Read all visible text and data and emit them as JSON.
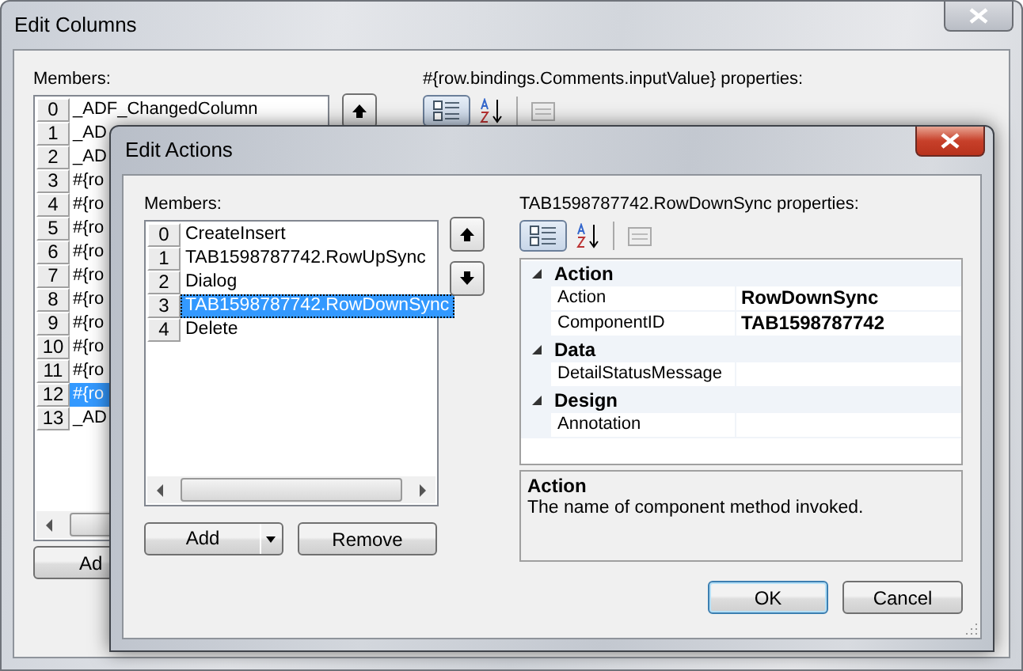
{
  "outer_window": {
    "title": "Edit Columns",
    "members_label": "Members:",
    "members": [
      {
        "index": "0",
        "name": "_ADF_ChangedColumn",
        "selected": false
      },
      {
        "index": "1",
        "name": "_AD",
        "selected": false
      },
      {
        "index": "2",
        "name": "_AD",
        "selected": false
      },
      {
        "index": "3",
        "name": "#{ro",
        "selected": false
      },
      {
        "index": "4",
        "name": "#{ro",
        "selected": false
      },
      {
        "index": "5",
        "name": "#{ro",
        "selected": false
      },
      {
        "index": "6",
        "name": "#{ro",
        "selected": false
      },
      {
        "index": "7",
        "name": "#{ro",
        "selected": false
      },
      {
        "index": "8",
        "name": "#{ro",
        "selected": false
      },
      {
        "index": "9",
        "name": "#{ro",
        "selected": false
      },
      {
        "index": "10",
        "name": "#{ro",
        "selected": false
      },
      {
        "index": "11",
        "name": "#{ro",
        "selected": false
      },
      {
        "index": "12",
        "name": "#{ro",
        "selected": true
      },
      {
        "index": "13",
        "name": "_AD",
        "selected": false
      }
    ],
    "add_button": "Ad",
    "properties_label": "#{row.bindings.Comments.inputValue} properties:",
    "toolbar": [
      {
        "kind": "categorized",
        "selected": true
      },
      {
        "kind": "alphabetical",
        "selected": false
      },
      {
        "kind": "pages",
        "selected": false
      }
    ]
  },
  "dialog": {
    "title": "Edit Actions",
    "members_label": "Members:",
    "members": [
      {
        "index": "0",
        "name": "CreateInsert",
        "selected": false
      },
      {
        "index": "1",
        "name": "TAB1598787742.RowUpSync",
        "selected": false
      },
      {
        "index": "2",
        "name": "Dialog",
        "selected": false
      },
      {
        "index": "3",
        "name": "TAB1598787742.RowDownSync",
        "selected": true
      },
      {
        "index": "4",
        "name": "Delete",
        "selected": false
      }
    ],
    "add_button": "Add",
    "remove_button": "Remove",
    "properties_label": "TAB1598787742.RowDownSync properties:",
    "toolbar": [
      {
        "kind": "categorized",
        "selected": true
      },
      {
        "kind": "alphabetical",
        "selected": false
      },
      {
        "kind": "pages",
        "selected": false
      }
    ],
    "property_grid": [
      {
        "category": "Action",
        "expanded": true,
        "properties": [
          {
            "name": "Action",
            "value": "RowDownSync"
          },
          {
            "name": "ComponentID",
            "value": "TAB1598787742"
          }
        ]
      },
      {
        "category": "Data",
        "expanded": true,
        "properties": [
          {
            "name": "DetailStatusMessage"
          }
        ]
      },
      {
        "category": "Design",
        "expanded": true,
        "properties": [
          {
            "name": "Annotation"
          }
        ]
      }
    ],
    "description": {
      "title": "Action",
      "text": "The name of component method invoked."
    },
    "ok_button": "OK",
    "cancel_button": "Cancel"
  }
}
